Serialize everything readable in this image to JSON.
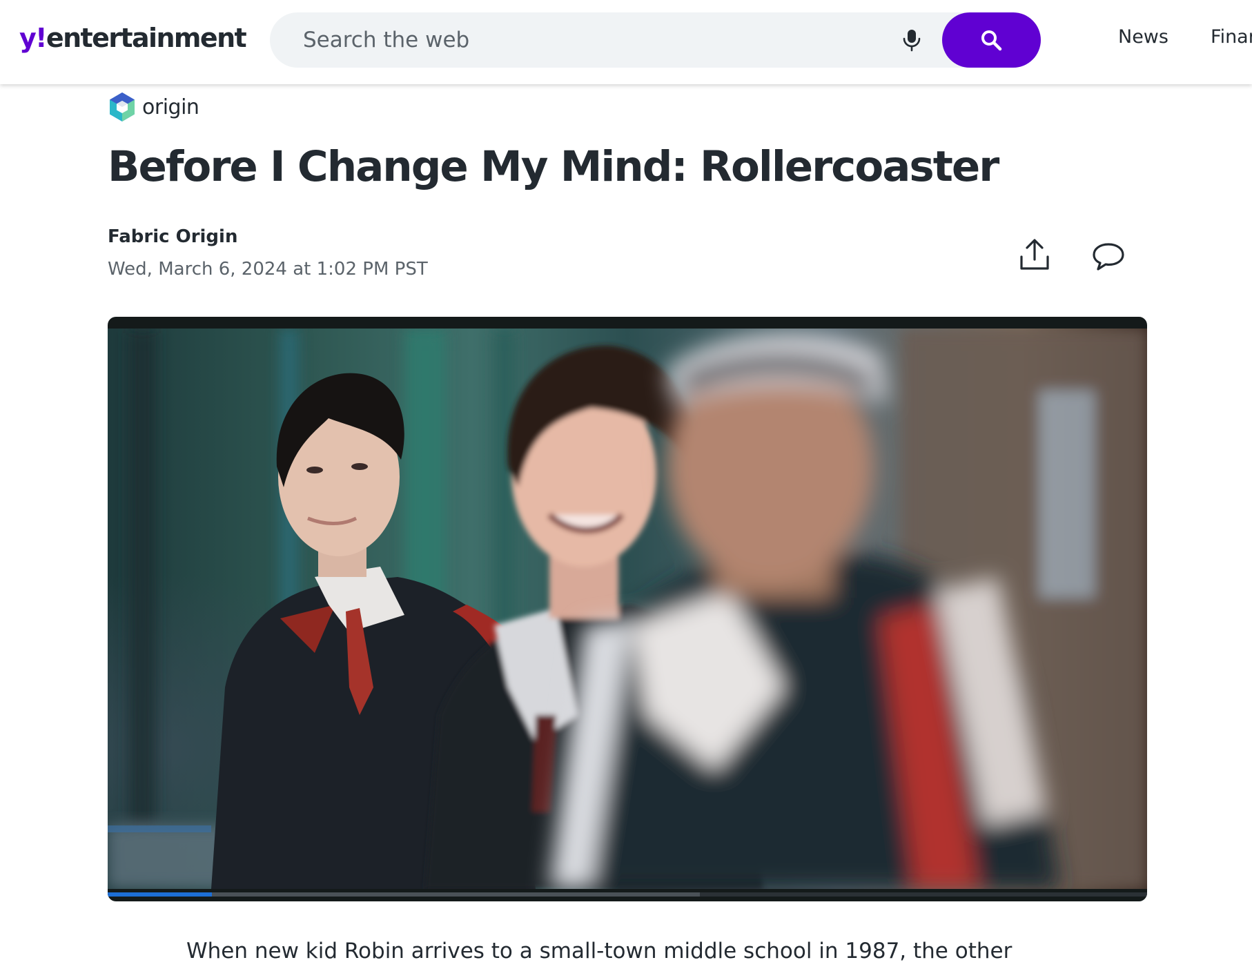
{
  "header": {
    "logo_mark": "y!",
    "logo_text": "entertainment",
    "search_placeholder": "Search the web",
    "nav": {
      "news_label": "News",
      "finance_label": "Finar"
    },
    "icons": {
      "mic": "microphone-icon",
      "search": "magnifier-icon"
    },
    "colors": {
      "brand": "#6001d2"
    }
  },
  "article": {
    "provider": "origin",
    "title": "Before I Change My Mind: Rollercoaster",
    "author": "Fabric Origin",
    "date": "Wed, March 6, 2024 at 1:02 PM PST",
    "actions": {
      "share_icon": "share-upload-icon",
      "comment_icon": "speech-bubble-icon"
    },
    "video": {
      "progress_fraction": 0.1,
      "buffered_fraction": 0.57
    },
    "body_first_line": "When new kid Robin arrives to a small-town middle school in 1987, the other"
  }
}
